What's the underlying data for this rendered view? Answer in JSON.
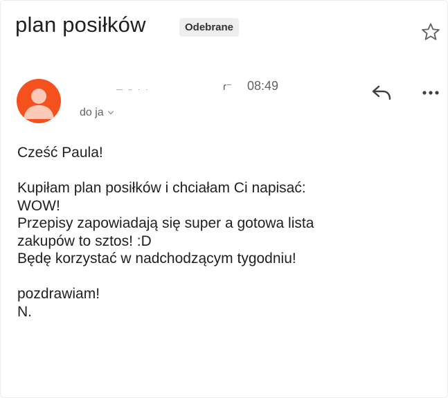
{
  "email": {
    "subject": "plan posiłków",
    "label": "Odebrane",
    "sender": "— – · ·",
    "time_prefix": "ɾ⁻",
    "time": "08:49",
    "recipient": "do ja",
    "body": {
      "greeting": "Cześć Paula!",
      "line1": "Kupiłam plan posiłków i chciałam Ci napisać:",
      "line2": "WOW!",
      "line3": "Przepisy zapowiadają się super a gotowa lista",
      "line4": "zakupów to sztos! :D",
      "line5": "Będę korzystać w nadchodzącym tygodniu!",
      "signoff": "pozdrawiam!",
      "signature": "N."
    }
  },
  "icons": {
    "star": "star-icon",
    "avatar": "person-avatar-icon",
    "reply": "reply-icon",
    "more": "more-horizontal-icon",
    "recipient_toggle": "chevron-down-icon"
  },
  "colors": {
    "avatar_bg": "#f4511e",
    "avatar_fg": "#fbc9b6",
    "badge_bg": "#eeeeee"
  }
}
